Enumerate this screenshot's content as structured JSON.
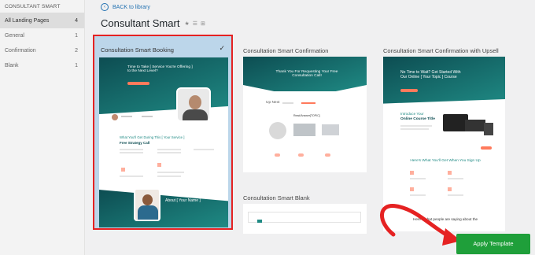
{
  "sidebar": {
    "header": "CONSULTANT SMART",
    "items": [
      {
        "label": "All Landing Pages",
        "count": "4"
      },
      {
        "label": "General",
        "count": "1"
      },
      {
        "label": "Confirmation",
        "count": "2"
      },
      {
        "label": "Blank",
        "count": "1"
      }
    ]
  },
  "header": {
    "back_label": "BACK to library",
    "title": "Consultant Smart"
  },
  "templates": [
    {
      "title": "Consultation Smart Booking",
      "hero_line1": "Time to Take [ Service You're Offering ]",
      "hero_line2": "to the Next Level?",
      "section_title": "What You'll Get During This [ Your Service ]",
      "section_sub": "Free Strategy Call",
      "about": "About [ Your Name ]"
    },
    {
      "title": "Consultation Smart Confirmation",
      "hero_line1": "Thank You For Requesting Your Free",
      "hero_line2": "Consultation Call!",
      "up_next": "Up Next",
      "ready": "Read/Answer[TOPIC]"
    },
    {
      "title": "Consultation Smart Blank"
    },
    {
      "title": "Consultation Smart Confirmation with Upsell",
      "hero_line1": "No Time to Wait? Get Started With",
      "hero_line2": "Our Online [ Your Topic ] Course",
      "intro1": "Introduce Your",
      "intro2": "Online Course Title",
      "get": "Here's What You'll Get When You Sign Up",
      "bottom": "Here's what people are saying about the"
    }
  ],
  "apply_label": "Apply Template",
  "colors": {
    "teal_dark": "#0d4d52",
    "teal": "#1f8a84",
    "accent": "#ff7a5c",
    "green": "#1f9f3a",
    "red": "#e52222"
  }
}
